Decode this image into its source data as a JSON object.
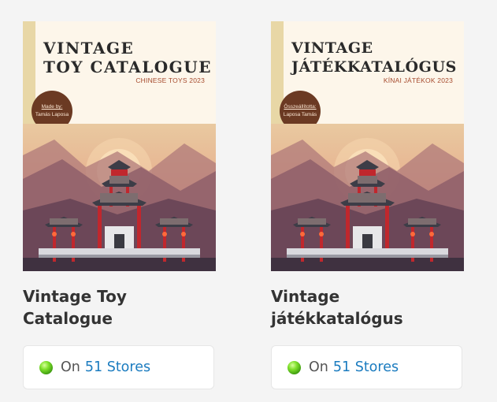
{
  "products": [
    {
      "cover_title_line1": "VINTAGE",
      "cover_title_line2": "TOY CATALOGUE",
      "cover_subtitle": "CHINESE TOYS 2023",
      "badge_label": "Made by:",
      "badge_name": "Tamás Laposa",
      "name_line1": "Vintage Toy",
      "name_line2": "Catalogue",
      "stores_prefix": "On",
      "stores_link": "51 Stores"
    },
    {
      "cover_title_line1": "VINTAGE",
      "cover_title_line2": "JÁTÉKKATALÓGUS",
      "cover_subtitle": "KÍNAI JÁTÉKOK 2023",
      "badge_label": "Összeállította:",
      "badge_name": "Laposa Tamás",
      "name_line1": "Vintage",
      "name_line2": "játékkatalógus",
      "stores_prefix": "On",
      "stores_link": "51 Stores"
    }
  ],
  "colors": {
    "cover_bg": "#e8d7a6",
    "panel_bg": "#fdf6ea",
    "badge_bg": "#6b3a23",
    "link": "#1a7bbf",
    "status_dot": "#5cc11a"
  }
}
